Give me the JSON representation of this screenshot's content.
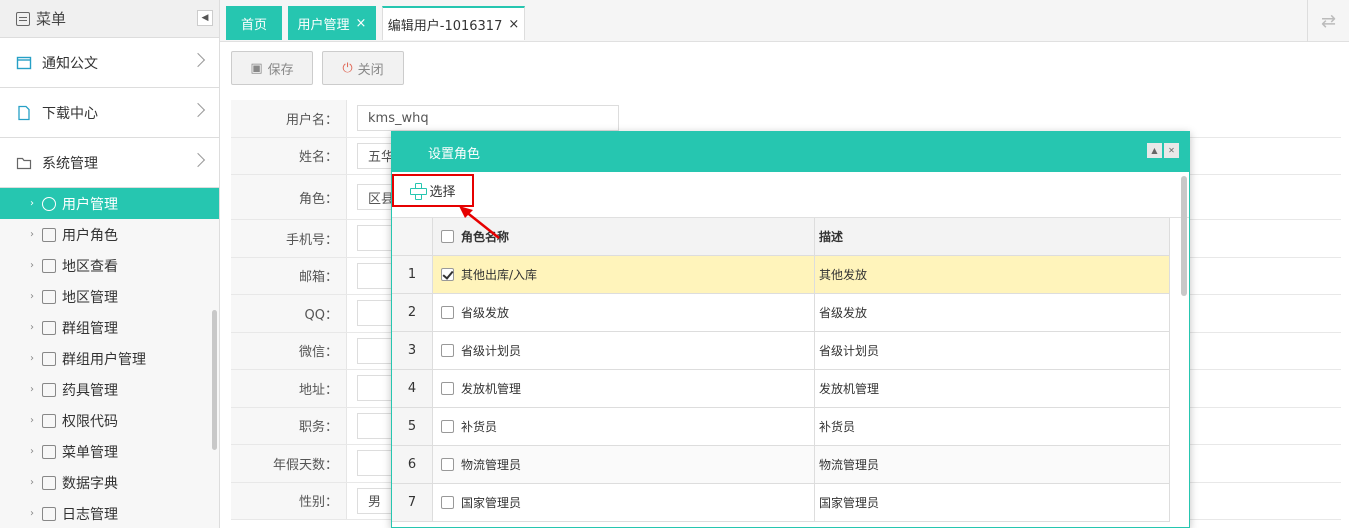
{
  "sidebar": {
    "title": "菜单",
    "collapse_glyph": "◀",
    "groups": [
      {
        "label": "通知公文",
        "icon": "window-icon"
      },
      {
        "label": "下载中心",
        "icon": "file-icon"
      },
      {
        "label": "系统管理",
        "icon": "folder-icon"
      }
    ],
    "items": [
      {
        "label": "用户管理",
        "icon": "user-icon"
      },
      {
        "label": "用户角色",
        "icon": "user-role-icon"
      },
      {
        "label": "地区查看",
        "icon": "sitemap-icon"
      },
      {
        "label": "地区管理",
        "icon": "folder-icon"
      },
      {
        "label": "群组管理",
        "icon": "group-icon"
      },
      {
        "label": "群组用户管理",
        "icon": "group-user-icon"
      },
      {
        "label": "药具管理",
        "icon": "folder-icon"
      },
      {
        "label": "权限代码",
        "icon": "key-icon"
      },
      {
        "label": "菜单管理",
        "icon": "list-icon"
      },
      {
        "label": "数据字典",
        "icon": "book-icon"
      },
      {
        "label": "日志管理",
        "icon": "log-icon"
      }
    ],
    "active_index": 0
  },
  "tabs": [
    {
      "label": "首页",
      "closable": false
    },
    {
      "label": "用户管理",
      "closable": true,
      "close": "×"
    },
    {
      "label": "编辑用户-1016317",
      "closable": true,
      "close": "×"
    }
  ],
  "toolbar": {
    "save_label": "保存",
    "close_label": "关闭"
  },
  "form": {
    "rows": [
      {
        "label": "用户名：",
        "value": "kms_whq"
      },
      {
        "label": "姓名：",
        "value": "五华"
      },
      {
        "label": "角色：",
        "value": "区县"
      },
      {
        "label": "手机号：",
        "value": ""
      },
      {
        "label": "邮箱：",
        "value": ""
      },
      {
        "label": "QQ：",
        "value": ""
      },
      {
        "label": "微信：",
        "value": ""
      },
      {
        "label": "地址：",
        "value": ""
      },
      {
        "label": "职务：",
        "value": ""
      },
      {
        "label": "年假天数：",
        "value": ""
      },
      {
        "label": "性别：",
        "value": "男"
      }
    ]
  },
  "dialog": {
    "title": "设置角色",
    "select_label": "选择",
    "columns": [
      "角色名称",
      "描述"
    ],
    "rows": [
      {
        "num": "1",
        "name": "其他出库/入库",
        "desc": "其他发放",
        "checked": true
      },
      {
        "num": "2",
        "name": "省级发放",
        "desc": "省级发放",
        "checked": false
      },
      {
        "num": "3",
        "name": "省级计划员",
        "desc": "省级计划员",
        "checked": false
      },
      {
        "num": "4",
        "name": "发放机管理",
        "desc": "发放机管理",
        "checked": false
      },
      {
        "num": "5",
        "name": "补货员",
        "desc": "补货员",
        "checked": false
      },
      {
        "num": "6",
        "name": "物流管理员",
        "desc": "物流管理员",
        "checked": false
      },
      {
        "num": "7",
        "name": "国家管理员",
        "desc": "国家管理员",
        "checked": false
      }
    ]
  },
  "colors": {
    "accent": "#26c6b0",
    "highlight": "#e60000",
    "selected_row": "#fff4bb"
  }
}
